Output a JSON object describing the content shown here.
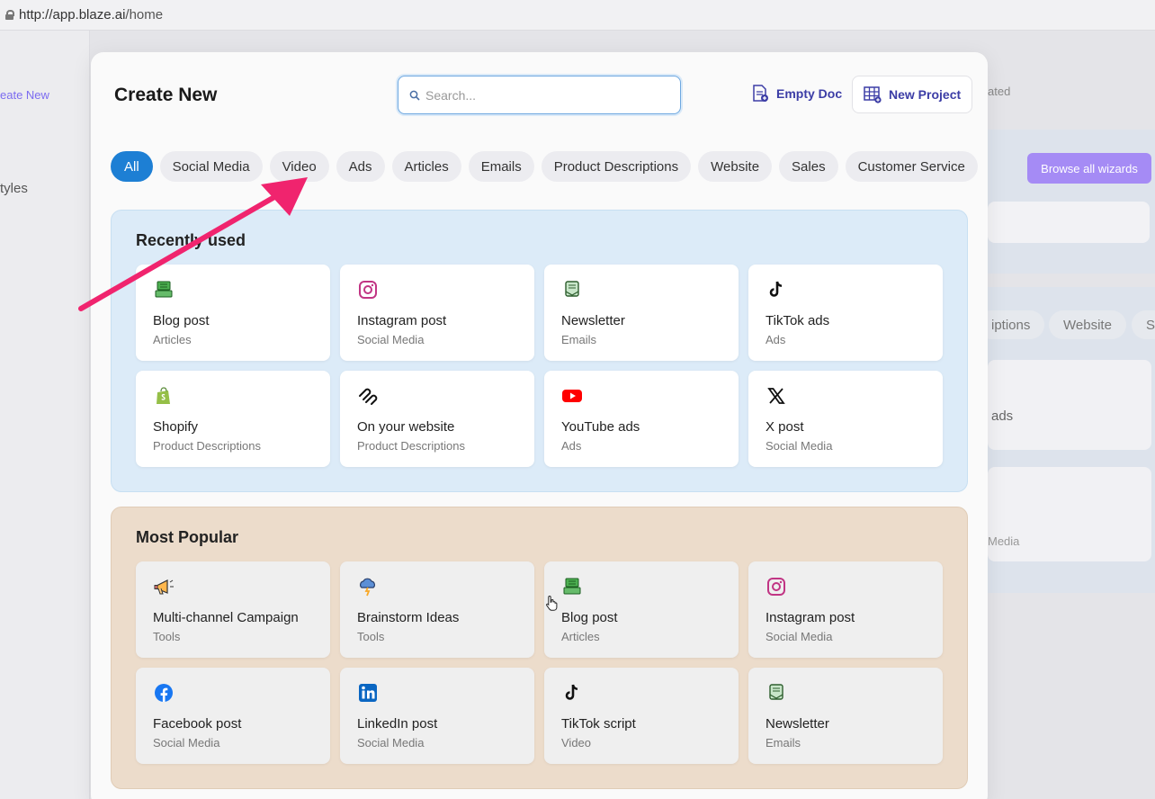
{
  "browser": {
    "url_host": "http://app.blaze.ai",
    "url_path": "/home"
  },
  "background": {
    "create_new": "eate New",
    "styles": "tyles",
    "rated": "ated",
    "browse_button": "Browse all wizards",
    "chip_descriptions": "iptions",
    "chip_website": "Website",
    "chip_sa": "Sa",
    "card_ads": "ads",
    "card_media": "Media"
  },
  "modal": {
    "title": "Create New",
    "search_placeholder": "Search...",
    "empty_doc": "Empty Doc",
    "new_project": "New Project",
    "tabs": [
      "All",
      "Social Media",
      "Video",
      "Ads",
      "Articles",
      "Emails",
      "Product Descriptions",
      "Website",
      "Sales",
      "Customer Service"
    ],
    "recently_used": {
      "title": "Recently used",
      "cards": [
        {
          "name": "Blog post",
          "category": "Articles",
          "icon": "blog-icon"
        },
        {
          "name": "Instagram post",
          "category": "Social Media",
          "icon": "instagram-icon"
        },
        {
          "name": "Newsletter",
          "category": "Emails",
          "icon": "newsletter-icon"
        },
        {
          "name": "TikTok ads",
          "category": "Ads",
          "icon": "tiktok-icon"
        },
        {
          "name": "Shopify",
          "category": "Product Descriptions",
          "icon": "shopify-icon"
        },
        {
          "name": "On your website",
          "category": "Product Descriptions",
          "icon": "squarespace-icon"
        },
        {
          "name": "YouTube ads",
          "category": "Ads",
          "icon": "youtube-icon"
        },
        {
          "name": "X post",
          "category": "Social Media",
          "icon": "x-icon"
        }
      ]
    },
    "most_popular": {
      "title": "Most Popular",
      "cards": [
        {
          "name": "Multi-channel Campaign",
          "category": "Tools",
          "icon": "megaphone-icon"
        },
        {
          "name": "Brainstorm Ideas",
          "category": "Tools",
          "icon": "brainstorm-icon"
        },
        {
          "name": "Blog post",
          "category": "Articles",
          "icon": "blog-icon"
        },
        {
          "name": "Instagram post",
          "category": "Social Media",
          "icon": "instagram-icon"
        },
        {
          "name": "Facebook post",
          "category": "Social Media",
          "icon": "facebook-icon"
        },
        {
          "name": "LinkedIn post",
          "category": "Social Media",
          "icon": "linkedin-icon"
        },
        {
          "name": "TikTok script",
          "category": "Video",
          "icon": "tiktok-icon"
        },
        {
          "name": "Newsletter",
          "category": "Emails",
          "icon": "newsletter-icon"
        }
      ]
    }
  },
  "colors": {
    "accent": "#1d7fd4",
    "arrow": "#f0246e",
    "button_text": "#3c3da6",
    "recent_bg": "#dcebf8",
    "popular_bg": "#ecdccb"
  }
}
